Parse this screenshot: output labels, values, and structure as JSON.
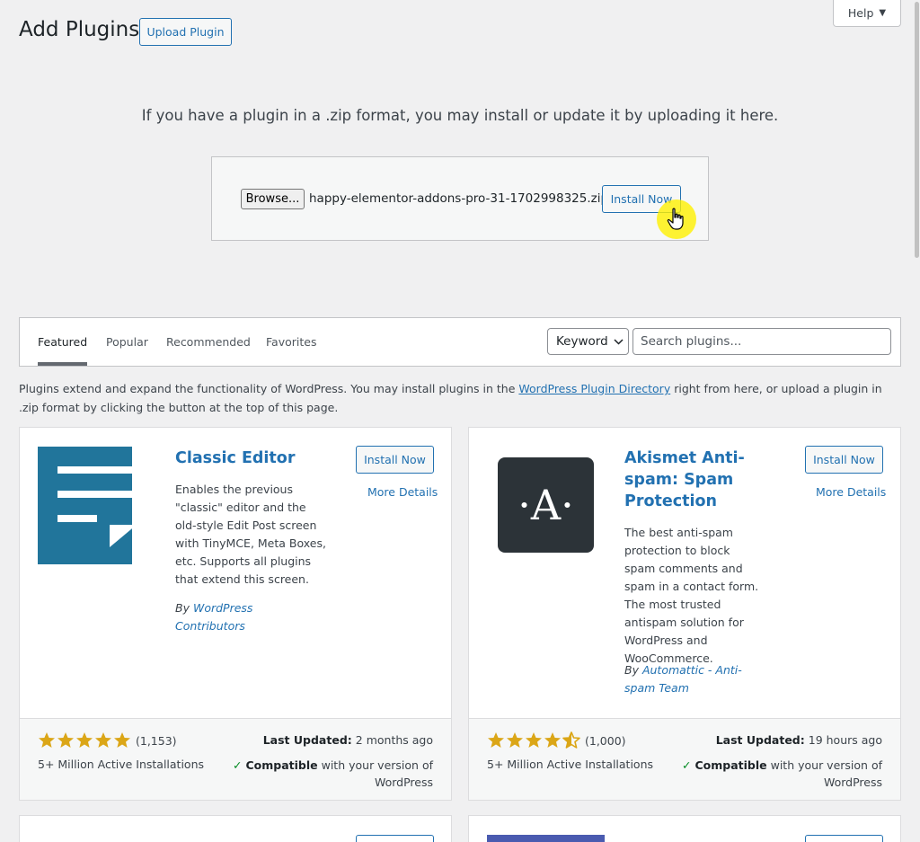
{
  "header": {
    "title": "Add Plugins",
    "upload_label": "Upload Plugin",
    "help_label": "Help"
  },
  "upload": {
    "help_text": "If you have a plugin in a .zip format, you may install or update it by uploading it here.",
    "browse_label": "Browse...",
    "file_name": "happy-elementor-addons-pro-31-1702998325.zip",
    "install_label": "Install Now"
  },
  "tabs": [
    "Featured",
    "Popular",
    "Recommended",
    "Favorites"
  ],
  "search": {
    "type_value": "Keyword",
    "placeholder": "Search plugins..."
  },
  "intro": {
    "before": "Plugins extend and expand the functionality of WordPress. You may install plugins in the ",
    "link": "WordPress Plugin Directory",
    "after": " right from here, or upload a plugin in .zip format by clicking the button at the top of this page."
  },
  "plugins": [
    {
      "name": "Classic Editor",
      "description": "Enables the previous \"classic\" editor and the old-style Edit Post screen with TinyMCE, Meta Boxes, etc. Supports all plugins that extend this screen.",
      "author_prefix": "By ",
      "author": "WordPress Contributors",
      "install_label": "Install Now",
      "details_label": "More Details",
      "rating": 5,
      "rating_count": "(1,153)",
      "installs": "5+ Million Active Installations",
      "last_updated_label": "Last Updated:",
      "last_updated": "2 months ago",
      "compat_strong": "Compatible",
      "compat_rest": "with your version of WordPress"
    },
    {
      "name": "Akismet Anti-spam: Spam Protection",
      "description": "The best anti-spam protection to block spam comments and spam in a contact form. The most trusted antispam solution for WordPress and WooCommerce.",
      "author_prefix": "By ",
      "author": "Automattic - Anti-spam Team",
      "install_label": "Install Now",
      "details_label": "More Details",
      "rating": 4.5,
      "rating_count": "(1,000)",
      "installs": "5+ Million Active Installations",
      "last_updated_label": "Last Updated:",
      "last_updated": "19 hours ago",
      "compat_strong": "Compatible",
      "compat_rest": "with your version of WordPress",
      "icon_letter": "·A·"
    }
  ],
  "colors": {
    "accent": "#2271b1",
    "star": "#dba617",
    "classic_icon": "#21759b",
    "akismet_icon": "#2c3338",
    "compatible": "#008a20",
    "cursor_highlight": "#fff000"
  }
}
